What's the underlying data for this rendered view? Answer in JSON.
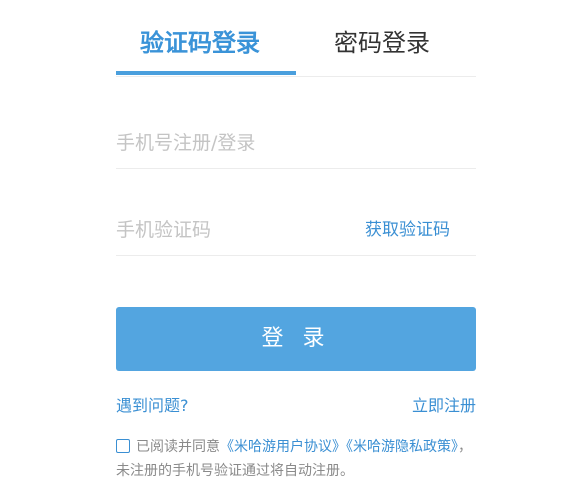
{
  "tabs": {
    "sms_login": "验证码登录",
    "password_login": "密码登录"
  },
  "form": {
    "phone_placeholder": "手机号注册/登录",
    "code_placeholder": "手机验证码",
    "get_code_label": "获取验证码",
    "login_button": "登 录"
  },
  "links": {
    "problem": "遇到问题?",
    "register": "立即注册"
  },
  "agreement": {
    "prefix": "已阅读并同意",
    "user_agreement": "《米哈游用户协议》",
    "privacy_policy": "《米哈游隐私政策》",
    "suffix": "，未注册的手机号验证通过将自动注册。"
  },
  "colors": {
    "accent": "#3a93d8",
    "button": "#53a5e0"
  }
}
